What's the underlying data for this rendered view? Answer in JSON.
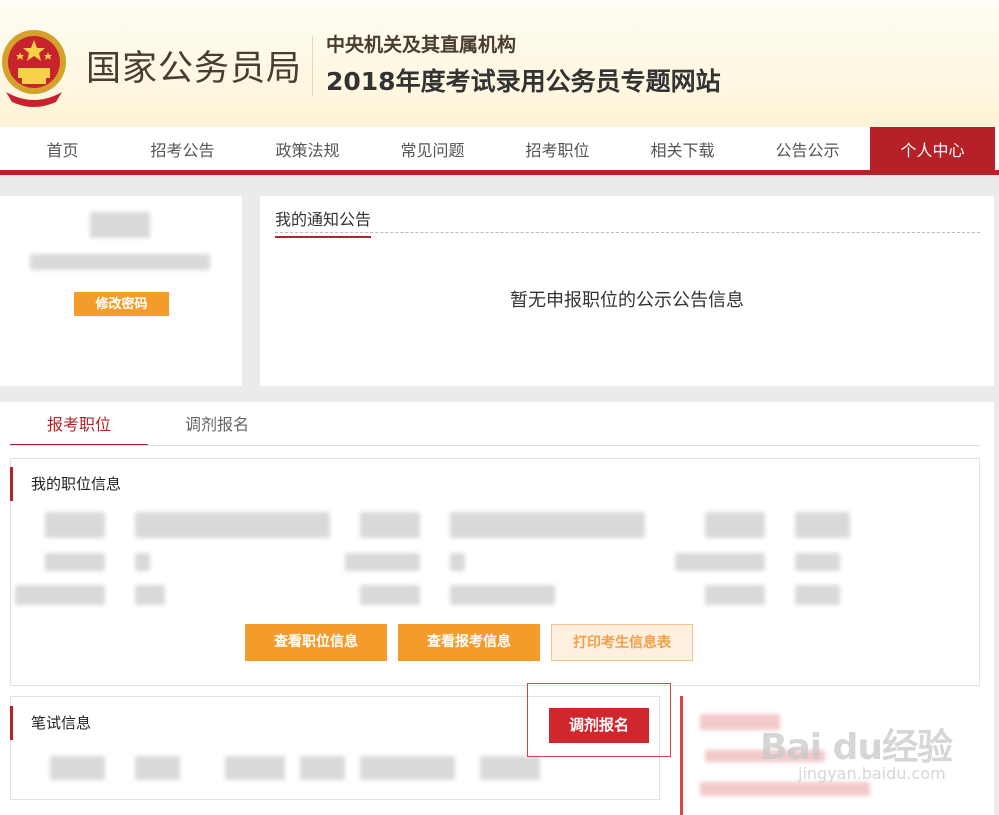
{
  "header": {
    "org_name": "国家公务员局",
    "subtitle_line1": "中央机关及其直属机构",
    "subtitle_line2": "2018年度考试录用公务员专题网站"
  },
  "nav": {
    "items": [
      {
        "label": "首页"
      },
      {
        "label": "招考公告"
      },
      {
        "label": "政策法规"
      },
      {
        "label": "常见问题"
      },
      {
        "label": "招考职位"
      },
      {
        "label": "相关下载"
      },
      {
        "label": "公告公示"
      },
      {
        "label": "个人中心",
        "active": true
      }
    ]
  },
  "profile": {
    "change_password_label": "修改密码"
  },
  "notice": {
    "tab_label": "我的通知公告",
    "empty_text": "暂无申报职位的公示公告信息"
  },
  "main_tabs": {
    "tab1": "报考职位",
    "tab2": "调剂报名"
  },
  "position_box": {
    "title": "我的职位信息",
    "btn_view_position": "查看职位信息",
    "btn_view_application": "查看报考信息",
    "btn_print": "打印考生信息表"
  },
  "exam_box": {
    "title": "笔试信息",
    "btn_adjust": "调剂报名"
  },
  "watermark": {
    "main": "Bai du经验",
    "sub": "jingyan.baidu.com"
  },
  "colors": {
    "brand_red": "#b52126",
    "orange": "#f39c2c",
    "button_red": "#d0262e"
  }
}
